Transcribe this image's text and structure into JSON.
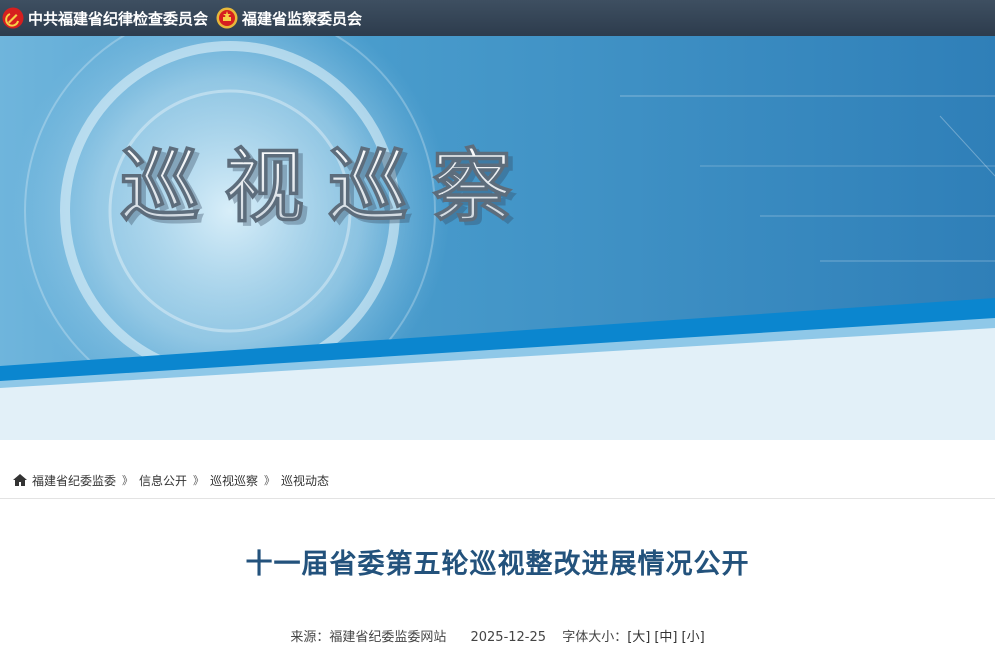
{
  "header": {
    "org1": "中共福建省纪律检查委员会",
    "org2": "福建省监察委员会"
  },
  "banner": {
    "title": "巡视巡察"
  },
  "breadcrumb": {
    "home": "福建省纪委监委",
    "items": [
      "信息公开",
      "巡视巡察",
      "巡视动态"
    ],
    "separator": "》"
  },
  "article": {
    "title": "十一届省委第五轮巡视整改进展情况公开",
    "source_label": "来源：",
    "source": "福建省纪委监委网站",
    "date": "2025-12-25",
    "font_label": "字体大小：",
    "font_large": "[大]",
    "font_medium": "[中]",
    "font_small": "[小]"
  },
  "colors": {
    "topbar": "#34465a",
    "title": "#23527c",
    "banner_blue": "#3c8fc4",
    "stripe": "#0b86cf"
  },
  "icons": {
    "emblem1": "party-emblem-icon",
    "emblem2": "national-emblem-icon",
    "home": "home-icon"
  }
}
